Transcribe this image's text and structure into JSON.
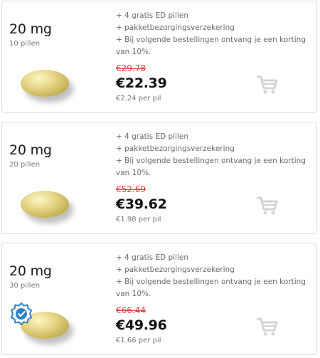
{
  "offers": [
    {
      "dose": "20 mg",
      "count": "10 pillen",
      "perks": [
        "+ 4 gratis ED pillen",
        "+ pakketbezorgingsverzekering",
        "+ Bij volgende bestellingen ontvang je een korting",
        "van 10%."
      ],
      "old_price": "€29.78",
      "price": "€22.39",
      "per_pill": "€2.24 per pil",
      "badge": false
    },
    {
      "dose": "20 mg",
      "count": "20 pillen",
      "perks": [
        "+ 4 gratis ED pillen",
        "+ pakketbezorgingsverzekering",
        "+ Bij volgende bestellingen ontvang je een korting",
        "van 10%."
      ],
      "old_price": "€52.69",
      "price": "€39.62",
      "per_pill": "€1.98 per pil",
      "badge": false
    },
    {
      "dose": "20 mg",
      "count": "30 pillen",
      "perks": [
        "+ 4 gratis ED pillen",
        "+ pakketbezorgingsverzekering",
        "+ Bij volgende bestellingen ontvang je een korting",
        "van 10%."
      ],
      "old_price": "€66.44",
      "price": "€49.96",
      "per_pill": "€1.66 per pil",
      "badge": true
    }
  ],
  "colors": {
    "old_price": "#e03b3b",
    "border": "#dcdcdc",
    "cart_icon": "#d4d4d4",
    "badge": "#2f80c8"
  },
  "icons": {
    "cart": "shopping-cart-icon",
    "badge": "verified-badge-icon",
    "pill": "pill-image"
  }
}
